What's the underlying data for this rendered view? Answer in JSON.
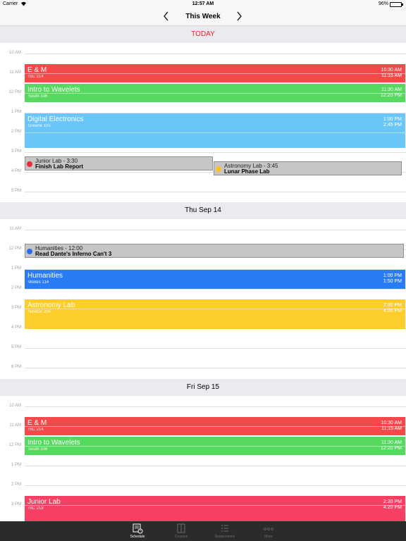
{
  "status": {
    "carrier": "Carrier",
    "time": "12:57 AM",
    "battery": "96%"
  },
  "nav": {
    "title": "This Week"
  },
  "days": [
    {
      "header": "TODAY",
      "hours": [
        "10 AM",
        "11 AM",
        "12 PM",
        "1 PM",
        "2 PM",
        "3 PM",
        "4 PM",
        "5 PM"
      ],
      "events": [
        {
          "name": "E & M",
          "location": "ISC 214",
          "start": "10:30 AM",
          "end": "11:15 AM",
          "color": "#f5484a"
        },
        {
          "name": "Intro to Wavelets",
          "location": "South 336",
          "start": "11:30 AM",
          "end": "12:20 PM",
          "color": "#56d95f"
        },
        {
          "name": "Digital Electronics",
          "location": "Greene 105",
          "start": "1:00 PM",
          "end": "2:45 PM",
          "color": "#6ac5f8"
        }
      ],
      "tasks": [
        {
          "course": "Junior Lab - 3:30",
          "title": "Finish Lab Report",
          "dot": "#ec2a3b"
        },
        {
          "course": "Astronomy Lab - 3:45",
          "title": "Lunar Phase Lab",
          "dot": "#f7c22a"
        }
      ]
    },
    {
      "header": "Thu Sep 14",
      "hours": [
        "11 AM",
        "12 PM",
        "1 PM",
        "2 PM",
        "3 PM",
        "4 PM",
        "5 PM",
        "6 PM"
      ],
      "events": [
        {
          "name": "Humanities",
          "location": "Welles 114",
          "start": "1:00 PM",
          "end": "1:50 PM",
          "color": "#2a7cf6"
        },
        {
          "name": "Astronomy Lab",
          "location": "Newton 204",
          "start": "2:30 PM",
          "end": "4:00 PM",
          "color": "#fccd2b"
        }
      ],
      "tasks": [
        {
          "course": "Humanities - 12:00",
          "title": "Read Dante's Inferno Can't 3",
          "dot": "#2a6cf4"
        }
      ]
    },
    {
      "header": "Fri Sep 15",
      "hours": [
        "10 AM",
        "11 AM",
        "12 PM",
        "1 PM",
        "2 PM",
        "3 PM"
      ],
      "events": [
        {
          "name": "E & M",
          "location": "ISC 214",
          "start": "10:30 AM",
          "end": "11:15 AM",
          "color": "#f5484a"
        },
        {
          "name": "Intro to Wavelets",
          "location": "South 336",
          "start": "11:30 AM",
          "end": "12:20 PM",
          "color": "#56d95f"
        },
        {
          "name": "Junior Lab",
          "location": "ISC 218",
          "start": "2:30 PM",
          "end": "4:20 PM",
          "color": "#f73e63"
        }
      ]
    }
  ],
  "tabs": [
    {
      "label": "Schedule",
      "icon": "schedule-icon",
      "active": true
    },
    {
      "label": "Courses",
      "icon": "courses-icon",
      "active": false
    },
    {
      "label": "Assignments",
      "icon": "assignments-icon",
      "active": false
    },
    {
      "label": "More",
      "icon": "more-icon",
      "active": false
    }
  ]
}
